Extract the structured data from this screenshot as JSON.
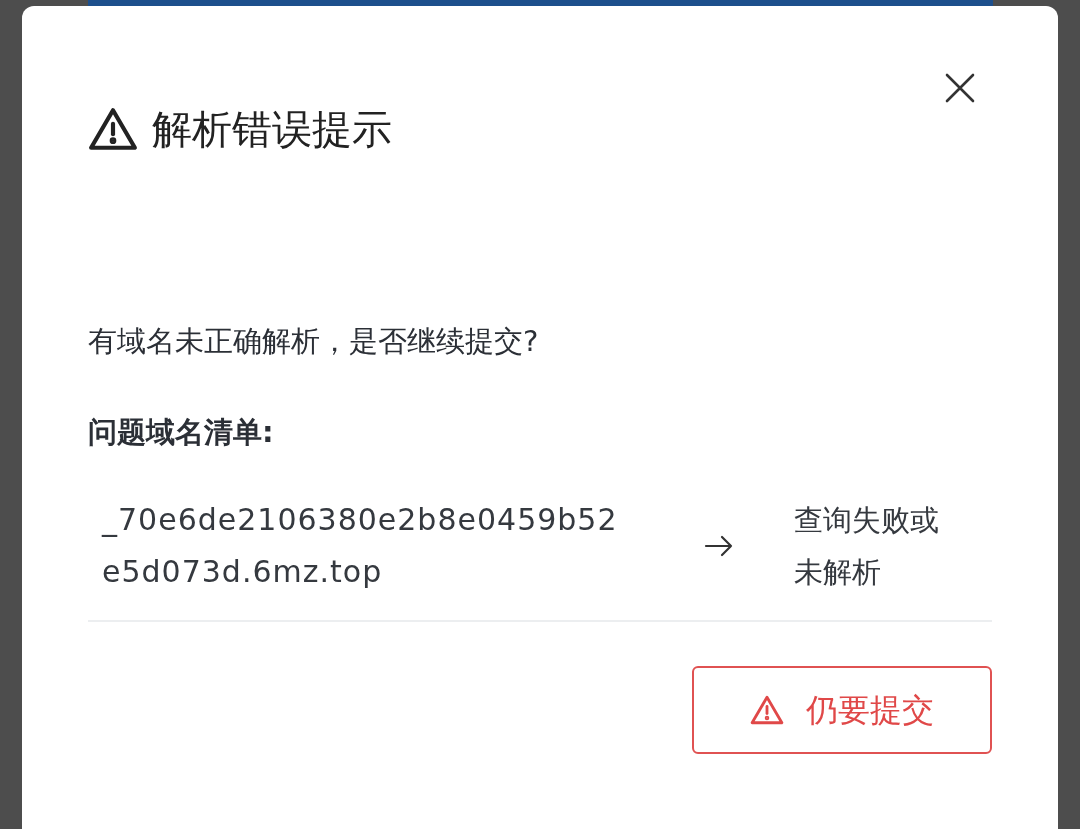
{
  "dialog": {
    "title": "解析错误提示",
    "message": "有域名未正确解析，是否继续提交?",
    "list_heading": "问题域名清单:",
    "domains": [
      {
        "domain": "_70e6de2106380e2b8e0459b52e5d073d.6mz.top",
        "status": "查询失败或未解析"
      }
    ],
    "buttons": [
      {
        "label": "仍要提交",
        "kind": "danger-outline"
      }
    ]
  }
}
